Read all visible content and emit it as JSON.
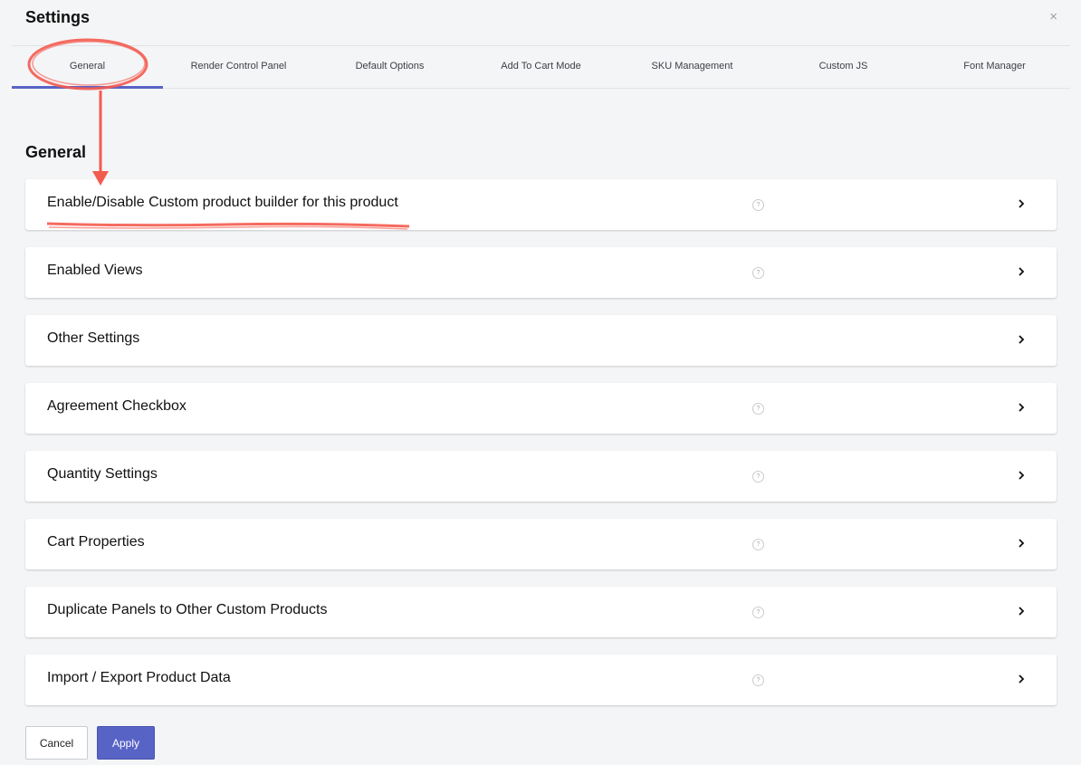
{
  "dialog": {
    "title": "Settings",
    "close_symbol": "×"
  },
  "tabs": [
    {
      "label": "General",
      "active": true
    },
    {
      "label": "Render Control Panel",
      "active": false
    },
    {
      "label": "Default Options",
      "active": false
    },
    {
      "label": "Add To Cart Mode",
      "active": false
    },
    {
      "label": "SKU Management",
      "active": false
    },
    {
      "label": "Custom JS",
      "active": false
    },
    {
      "label": "Font Manager",
      "active": false
    }
  ],
  "section": {
    "title": "General"
  },
  "panels": [
    {
      "label": "Enable/Disable Custom product builder for this product",
      "has_help": true
    },
    {
      "label": "Enabled Views",
      "has_help": true
    },
    {
      "label": "Other Settings",
      "has_help": false
    },
    {
      "label": "Agreement Checkbox",
      "has_help": true
    },
    {
      "label": "Quantity Settings",
      "has_help": true
    },
    {
      "label": "Cart Properties",
      "has_help": true
    },
    {
      "label": "Duplicate Panels to Other Custom Products",
      "has_help": true
    },
    {
      "label": "Import / Export Product Data",
      "has_help": true
    }
  ],
  "help_symbol": "?",
  "footer": {
    "cancel_label": "Cancel",
    "apply_label": "Apply"
  },
  "colors": {
    "accent": "#5863c6",
    "annotation": "#f45b4f",
    "background": "#f4f5f7"
  }
}
